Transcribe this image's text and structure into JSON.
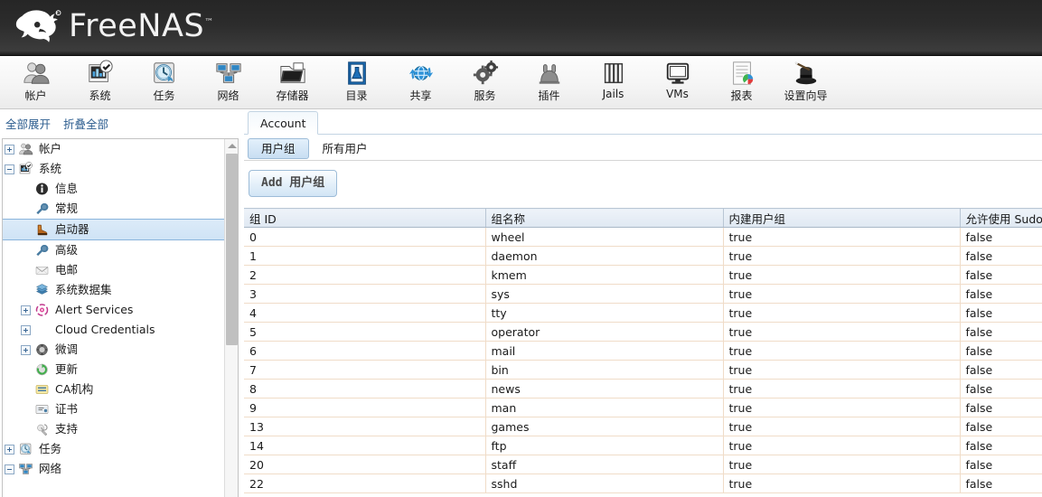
{
  "brand": {
    "name": "FreeNAS",
    "trademark": "™"
  },
  "toolbar": {
    "items": [
      {
        "label": "帐户",
        "icon": "users-icon"
      },
      {
        "label": "系统",
        "icon": "system-chart-check-icon"
      },
      {
        "label": "任务",
        "icon": "clock-tasks-icon"
      },
      {
        "label": "网络",
        "icon": "network-monitors-icon"
      },
      {
        "label": "存储器",
        "icon": "folder-storage-icon"
      },
      {
        "label": "目录",
        "icon": "directory-book-icon"
      },
      {
        "label": "共享",
        "icon": "sharing-globe-icon"
      },
      {
        "label": "服务",
        "icon": "services-gears-icon"
      },
      {
        "label": "插件",
        "icon": "plugins-icon"
      },
      {
        "label": "Jails",
        "icon": "jails-bars-icon"
      },
      {
        "label": "VMs",
        "icon": "vms-monitor-icon"
      },
      {
        "label": "报表",
        "icon": "reports-document-icon"
      },
      {
        "label": "设置向导",
        "icon": "wizard-hat-icon"
      }
    ]
  },
  "sidebar": {
    "expand_all": "全部展开",
    "collapse_all": "折叠全部",
    "tree": [
      {
        "label": "帐户",
        "icon": "users-icon",
        "toggle": "plus",
        "depth": 0,
        "selected": false
      },
      {
        "label": "系统",
        "icon": "system-chart-check-icon",
        "toggle": "minus",
        "depth": 0,
        "selected": false
      },
      {
        "label": "信息",
        "icon": "info-icon",
        "toggle": "none",
        "depth": 1,
        "selected": false
      },
      {
        "label": "常规",
        "icon": "wrench-icon",
        "toggle": "none",
        "depth": 1,
        "selected": false
      },
      {
        "label": "启动器",
        "icon": "boot-icon",
        "toggle": "none",
        "depth": 1,
        "selected": true
      },
      {
        "label": "高级",
        "icon": "wrench-icon",
        "toggle": "none",
        "depth": 1,
        "selected": false
      },
      {
        "label": "电邮",
        "icon": "mail-icon",
        "toggle": "none",
        "depth": 1,
        "selected": false
      },
      {
        "label": "系统数据集",
        "icon": "dataset-icon",
        "toggle": "none",
        "depth": 1,
        "selected": false
      },
      {
        "label": "Alert Services",
        "icon": "alert-icon",
        "toggle": "plus",
        "depth": 1,
        "selected": false
      },
      {
        "label": "Cloud Credentials",
        "icon": "none",
        "toggle": "plus",
        "depth": 1,
        "selected": false
      },
      {
        "label": "微调",
        "icon": "tunable-icon",
        "toggle": "plus",
        "depth": 1,
        "selected": false
      },
      {
        "label": "更新",
        "icon": "update-icon",
        "toggle": "none",
        "depth": 1,
        "selected": false
      },
      {
        "label": "CA机构",
        "icon": "ca-icon",
        "toggle": "none",
        "depth": 1,
        "selected": false
      },
      {
        "label": "证书",
        "icon": "certificate-icon",
        "toggle": "none",
        "depth": 1,
        "selected": false
      },
      {
        "label": "支持",
        "icon": "support-icon",
        "toggle": "none",
        "depth": 1,
        "selected": false
      },
      {
        "label": "任务",
        "icon": "clock-tasks-icon",
        "toggle": "plus",
        "depth": 0,
        "selected": false
      },
      {
        "label": "网络",
        "icon": "network-monitors-icon",
        "toggle": "minus",
        "depth": 0,
        "selected": false
      }
    ]
  },
  "main": {
    "tabs": [
      {
        "label": "Account",
        "active": true
      }
    ],
    "subtabs": [
      {
        "label": "用户组",
        "active": true
      },
      {
        "label": "所有用户",
        "active": false
      }
    ],
    "add_button": "Add 用户组",
    "grid": {
      "columns": [
        "组 ID",
        "组名称",
        "内建用户组",
        "允许使用 Sudo"
      ],
      "rows": [
        [
          "0",
          "wheel",
          "true",
          "false"
        ],
        [
          "1",
          "daemon",
          "true",
          "false"
        ],
        [
          "2",
          "kmem",
          "true",
          "false"
        ],
        [
          "3",
          "sys",
          "true",
          "false"
        ],
        [
          "4",
          "tty",
          "true",
          "false"
        ],
        [
          "5",
          "operator",
          "true",
          "false"
        ],
        [
          "6",
          "mail",
          "true",
          "false"
        ],
        [
          "7",
          "bin",
          "true",
          "false"
        ],
        [
          "8",
          "news",
          "true",
          "false"
        ],
        [
          "9",
          "man",
          "true",
          "false"
        ],
        [
          "13",
          "games",
          "true",
          "false"
        ],
        [
          "14",
          "ftp",
          "true",
          "false"
        ],
        [
          "20",
          "staff",
          "true",
          "false"
        ],
        [
          "22",
          "sshd",
          "true",
          "false"
        ]
      ]
    }
  },
  "colors": {
    "header_dark": "#2c2c2c",
    "link_blue": "#2c5d8f",
    "selection_blue": "#cfe3f6",
    "grid_border": "#f0dcc8"
  }
}
